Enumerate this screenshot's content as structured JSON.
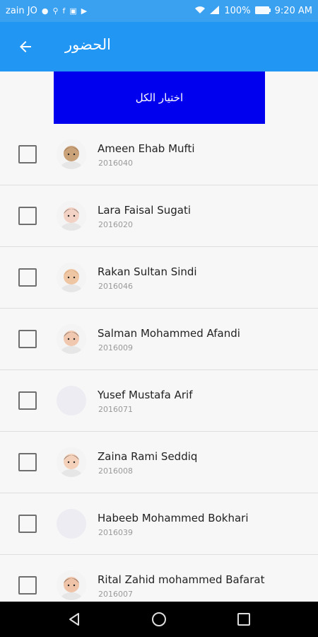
{
  "status_bar": {
    "carrier": "zain JO",
    "battery": "100%",
    "time": "9:20 AM"
  },
  "app_bar": {
    "title": "الحضور",
    "back_icon": "arrow-left-icon"
  },
  "select_all": {
    "label": "اختيار الكل",
    "color": "#0000ee"
  },
  "colors": {
    "status_bar": "#3aa0f0",
    "app_bar": "#2196f3",
    "background": "#f7f7f7"
  },
  "students": [
    {
      "name": "Ameen Ehab Mufti",
      "id": "2016040",
      "checked": false,
      "has_photo": true
    },
    {
      "name": "Lara Faisal Sugati",
      "id": "2016020",
      "checked": false,
      "has_photo": true
    },
    {
      "name": "Rakan Sultan Sindi",
      "id": "2016046",
      "checked": false,
      "has_photo": true
    },
    {
      "name": "Salman Mohammed Afandi",
      "id": "2016009",
      "checked": false,
      "has_photo": true
    },
    {
      "name": "Yusef Mustafa Arif",
      "id": "2016071",
      "checked": false,
      "has_photo": false
    },
    {
      "name": "Zaina Rami Seddiq",
      "id": "2016008",
      "checked": false,
      "has_photo": true
    },
    {
      "name": "Habeeb Mohammed Bokhari",
      "id": "2016039",
      "checked": false,
      "has_photo": false
    },
    {
      "name": "Rital Zahid mohammed Bafarat",
      "id": "2016007",
      "checked": false,
      "has_photo": true
    }
  ],
  "nav_bar": {
    "buttons": [
      "back-triangle-icon",
      "home-circle-icon",
      "recents-square-icon"
    ]
  }
}
